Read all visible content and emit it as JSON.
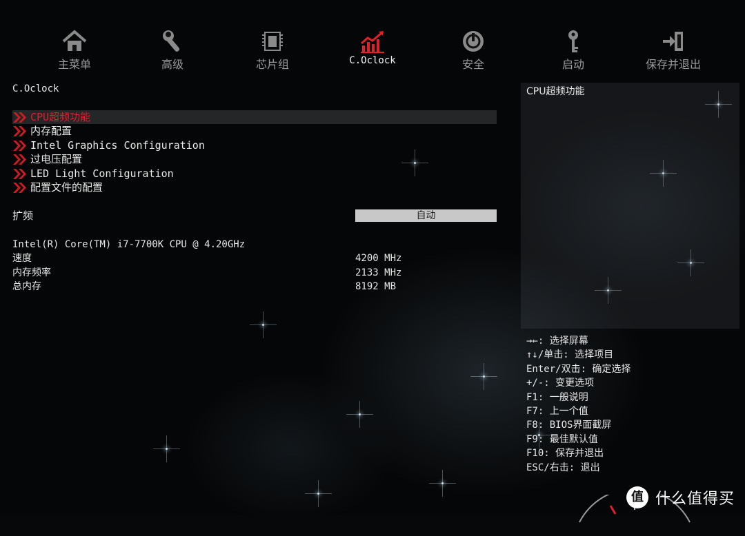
{
  "topnav": {
    "items": [
      {
        "label": "主菜单",
        "icon": "home-icon"
      },
      {
        "label": "高级",
        "icon": "wrench-icon"
      },
      {
        "label": "芯片组",
        "icon": "chip-icon"
      },
      {
        "label": "C.Oclock",
        "icon": "chart-icon"
      },
      {
        "label": "安全",
        "icon": "power-shield-icon"
      },
      {
        "label": "启动",
        "icon": "key-icon"
      },
      {
        "label": "保存并退出",
        "icon": "exit-icon"
      }
    ],
    "active_index": 3,
    "accent_color": "#e0202a"
  },
  "page_title": "C.Oclock",
  "menu": {
    "items": [
      {
        "label": "CPU超频功能"
      },
      {
        "label": "内存配置"
      },
      {
        "label": "Intel Graphics Configuration"
      },
      {
        "label": "过电压配置"
      },
      {
        "label": "LED Light Configuration"
      },
      {
        "label": "配置文件的配置"
      }
    ],
    "selected_index": 0
  },
  "overclock": {
    "label": "扩频",
    "value": "自动"
  },
  "info": {
    "cpu": "Intel(R) Core(TM) i7-7700K CPU @ 4.20GHz",
    "rows": [
      {
        "label": "速度",
        "value": "4200 MHz"
      },
      {
        "label": "内存频率",
        "value": "2133 MHz"
      },
      {
        "label": "总内存",
        "value": "8192 MB"
      }
    ]
  },
  "help": {
    "title": "CPU超频功能"
  },
  "keys": [
    "→←: 选择屏幕",
    "↑↓/单击: 选择项目",
    "Enter/双击: 确定选择",
    "+/-: 变更选项",
    "F1: 一般说明",
    "F7: 上一个值",
    "F8: BIOS界面截屏",
    "F9: 最佳默认值",
    "F10: 保存并退出",
    "ESC/右击: 退出"
  ],
  "watermark": {
    "logo": "值",
    "text": "什么值得买"
  }
}
